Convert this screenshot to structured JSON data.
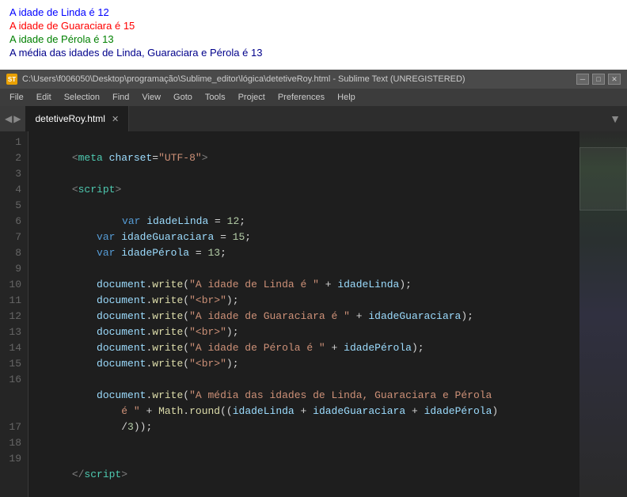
{
  "browser_output": {
    "lines": [
      {
        "text": "A idade de Linda é 12",
        "color": "blue"
      },
      {
        "text": "A idade de Guaraciara é 15",
        "color": "red"
      },
      {
        "text": "A idade de Pérola é 13",
        "color": "green"
      },
      {
        "text": "A média das idades de Linda, Guaraciara e Pérola é 13",
        "color": "darkblue"
      }
    ]
  },
  "title_bar": {
    "text": "C:\\Users\\f006050\\Desktop\\programação\\Sublime_editor\\lógica\\detetiveRoy.html - Sublime Text (UNREGISTERED)",
    "icon": "ST"
  },
  "menu": {
    "items": [
      "File",
      "Edit",
      "Selection",
      "Find",
      "View",
      "Goto",
      "Tools",
      "Project",
      "Preferences",
      "Help"
    ]
  },
  "tabs": {
    "active": "detetiveRoy.html"
  },
  "line_numbers": [
    1,
    2,
    3,
    4,
    5,
    6,
    7,
    8,
    9,
    10,
    11,
    12,
    13,
    14,
    15,
    16,
    "",
    "",
    17,
    18,
    19
  ]
}
